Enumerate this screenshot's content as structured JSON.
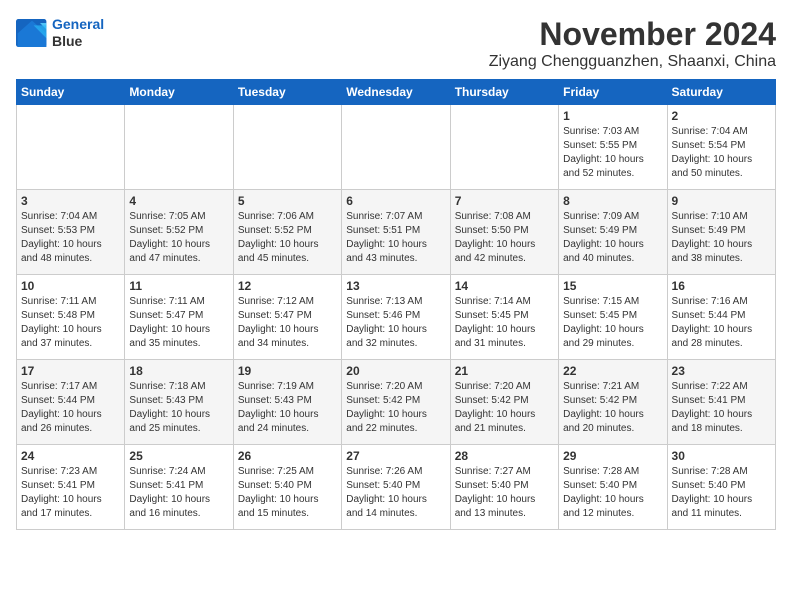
{
  "logo": {
    "line1": "General",
    "line2": "Blue"
  },
  "title": "November 2024",
  "subtitle": "Ziyang Chengguanzhen, Shaanxi, China",
  "weekdays": [
    "Sunday",
    "Monday",
    "Tuesday",
    "Wednesday",
    "Thursday",
    "Friday",
    "Saturday"
  ],
  "weeks": [
    [
      {
        "day": "",
        "info": ""
      },
      {
        "day": "",
        "info": ""
      },
      {
        "day": "",
        "info": ""
      },
      {
        "day": "",
        "info": ""
      },
      {
        "day": "",
        "info": ""
      },
      {
        "day": "1",
        "info": "Sunrise: 7:03 AM\nSunset: 5:55 PM\nDaylight: 10 hours\nand 52 minutes."
      },
      {
        "day": "2",
        "info": "Sunrise: 7:04 AM\nSunset: 5:54 PM\nDaylight: 10 hours\nand 50 minutes."
      }
    ],
    [
      {
        "day": "3",
        "info": "Sunrise: 7:04 AM\nSunset: 5:53 PM\nDaylight: 10 hours\nand 48 minutes."
      },
      {
        "day": "4",
        "info": "Sunrise: 7:05 AM\nSunset: 5:52 PM\nDaylight: 10 hours\nand 47 minutes."
      },
      {
        "day": "5",
        "info": "Sunrise: 7:06 AM\nSunset: 5:52 PM\nDaylight: 10 hours\nand 45 minutes."
      },
      {
        "day": "6",
        "info": "Sunrise: 7:07 AM\nSunset: 5:51 PM\nDaylight: 10 hours\nand 43 minutes."
      },
      {
        "day": "7",
        "info": "Sunrise: 7:08 AM\nSunset: 5:50 PM\nDaylight: 10 hours\nand 42 minutes."
      },
      {
        "day": "8",
        "info": "Sunrise: 7:09 AM\nSunset: 5:49 PM\nDaylight: 10 hours\nand 40 minutes."
      },
      {
        "day": "9",
        "info": "Sunrise: 7:10 AM\nSunset: 5:49 PM\nDaylight: 10 hours\nand 38 minutes."
      }
    ],
    [
      {
        "day": "10",
        "info": "Sunrise: 7:11 AM\nSunset: 5:48 PM\nDaylight: 10 hours\nand 37 minutes."
      },
      {
        "day": "11",
        "info": "Sunrise: 7:11 AM\nSunset: 5:47 PM\nDaylight: 10 hours\nand 35 minutes."
      },
      {
        "day": "12",
        "info": "Sunrise: 7:12 AM\nSunset: 5:47 PM\nDaylight: 10 hours\nand 34 minutes."
      },
      {
        "day": "13",
        "info": "Sunrise: 7:13 AM\nSunset: 5:46 PM\nDaylight: 10 hours\nand 32 minutes."
      },
      {
        "day": "14",
        "info": "Sunrise: 7:14 AM\nSunset: 5:45 PM\nDaylight: 10 hours\nand 31 minutes."
      },
      {
        "day": "15",
        "info": "Sunrise: 7:15 AM\nSunset: 5:45 PM\nDaylight: 10 hours\nand 29 minutes."
      },
      {
        "day": "16",
        "info": "Sunrise: 7:16 AM\nSunset: 5:44 PM\nDaylight: 10 hours\nand 28 minutes."
      }
    ],
    [
      {
        "day": "17",
        "info": "Sunrise: 7:17 AM\nSunset: 5:44 PM\nDaylight: 10 hours\nand 26 minutes."
      },
      {
        "day": "18",
        "info": "Sunrise: 7:18 AM\nSunset: 5:43 PM\nDaylight: 10 hours\nand 25 minutes."
      },
      {
        "day": "19",
        "info": "Sunrise: 7:19 AM\nSunset: 5:43 PM\nDaylight: 10 hours\nand 24 minutes."
      },
      {
        "day": "20",
        "info": "Sunrise: 7:20 AM\nSunset: 5:42 PM\nDaylight: 10 hours\nand 22 minutes."
      },
      {
        "day": "21",
        "info": "Sunrise: 7:20 AM\nSunset: 5:42 PM\nDaylight: 10 hours\nand 21 minutes."
      },
      {
        "day": "22",
        "info": "Sunrise: 7:21 AM\nSunset: 5:42 PM\nDaylight: 10 hours\nand 20 minutes."
      },
      {
        "day": "23",
        "info": "Sunrise: 7:22 AM\nSunset: 5:41 PM\nDaylight: 10 hours\nand 18 minutes."
      }
    ],
    [
      {
        "day": "24",
        "info": "Sunrise: 7:23 AM\nSunset: 5:41 PM\nDaylight: 10 hours\nand 17 minutes."
      },
      {
        "day": "25",
        "info": "Sunrise: 7:24 AM\nSunset: 5:41 PM\nDaylight: 10 hours\nand 16 minutes."
      },
      {
        "day": "26",
        "info": "Sunrise: 7:25 AM\nSunset: 5:40 PM\nDaylight: 10 hours\nand 15 minutes."
      },
      {
        "day": "27",
        "info": "Sunrise: 7:26 AM\nSunset: 5:40 PM\nDaylight: 10 hours\nand 14 minutes."
      },
      {
        "day": "28",
        "info": "Sunrise: 7:27 AM\nSunset: 5:40 PM\nDaylight: 10 hours\nand 13 minutes."
      },
      {
        "day": "29",
        "info": "Sunrise: 7:28 AM\nSunset: 5:40 PM\nDaylight: 10 hours\nand 12 minutes."
      },
      {
        "day": "30",
        "info": "Sunrise: 7:28 AM\nSunset: 5:40 PM\nDaylight: 10 hours\nand 11 minutes."
      }
    ]
  ]
}
